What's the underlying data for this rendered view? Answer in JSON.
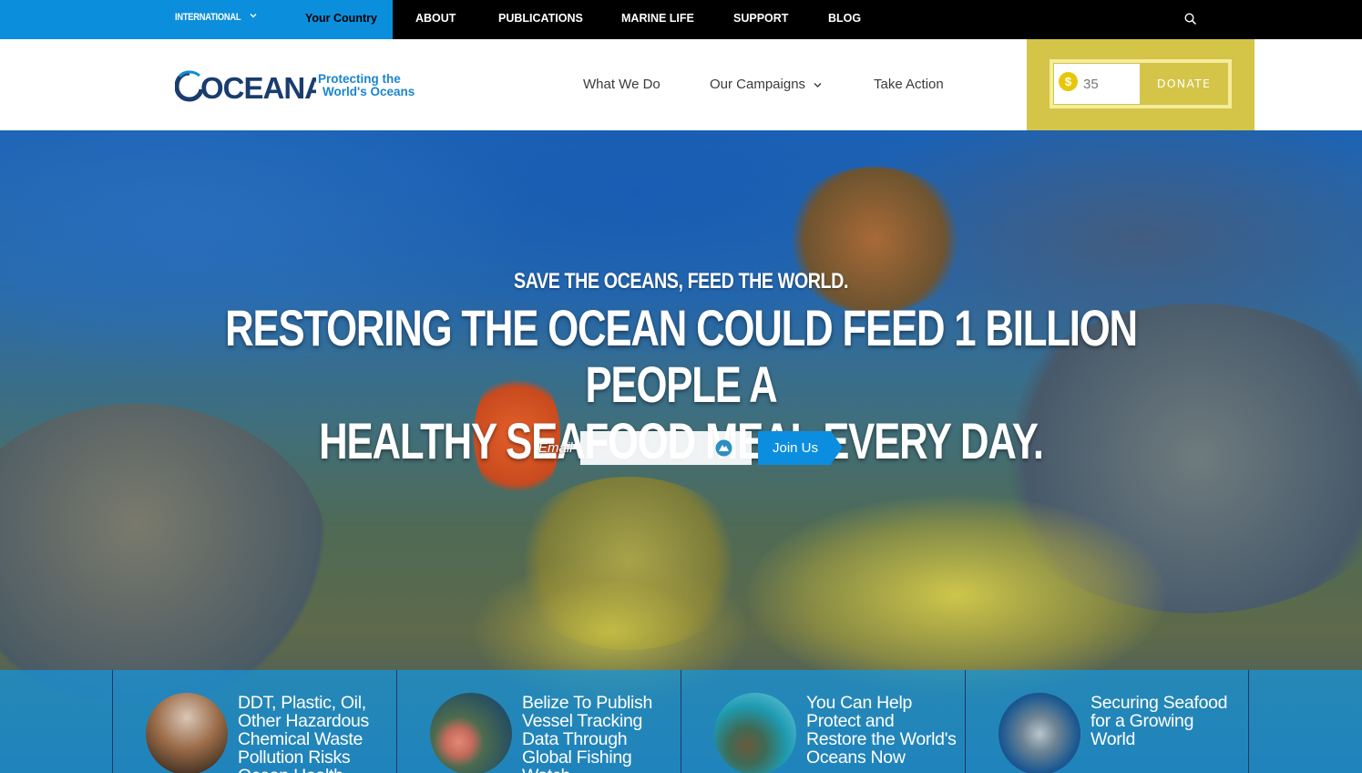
{
  "topbar": {
    "international": "INTERNATIONAL",
    "your_country": "Your Country",
    "links": [
      "ABOUT",
      "PUBLICATIONS",
      "MARINE LIFE",
      "SUPPORT",
      "BLOG"
    ],
    "search_icon": "search-icon",
    "accent_color": "#0b8fdc"
  },
  "header": {
    "logo_text": "OCEANA",
    "tagline_line1": "Protecting the",
    "tagline_line2": "World's Oceans",
    "nav": [
      "What We Do",
      "Our Campaigns",
      "Take Action"
    ],
    "donate": {
      "currency_symbol": "$",
      "amount": "35",
      "button_label": "DONATE",
      "panel_color": "#d4c448"
    }
  },
  "hero": {
    "subtitle": "SAVE THE OCEANS, FEED THE WORLD.",
    "title_line1": "RESTORING THE OCEAN COULD FEED 1 BILLION PEOPLE A",
    "title_line2": "HEALTHY SEAFOOD MEAL EVERY DAY.",
    "email_label": "Email",
    "email_value": "",
    "join_label": "Join Us"
  },
  "cards": [
    {
      "title": "DDT, Plastic, Oil, Other Hazardous Chemical Waste Pollution Risks Ocean Health"
    },
    {
      "title": "Belize To Publish Vessel Tracking Data Through Global Fishing Watch"
    },
    {
      "title": "You Can Help Protect and Restore the World's Oceans Now"
    },
    {
      "title": "Securing Seafood for a Growing World"
    }
  ]
}
